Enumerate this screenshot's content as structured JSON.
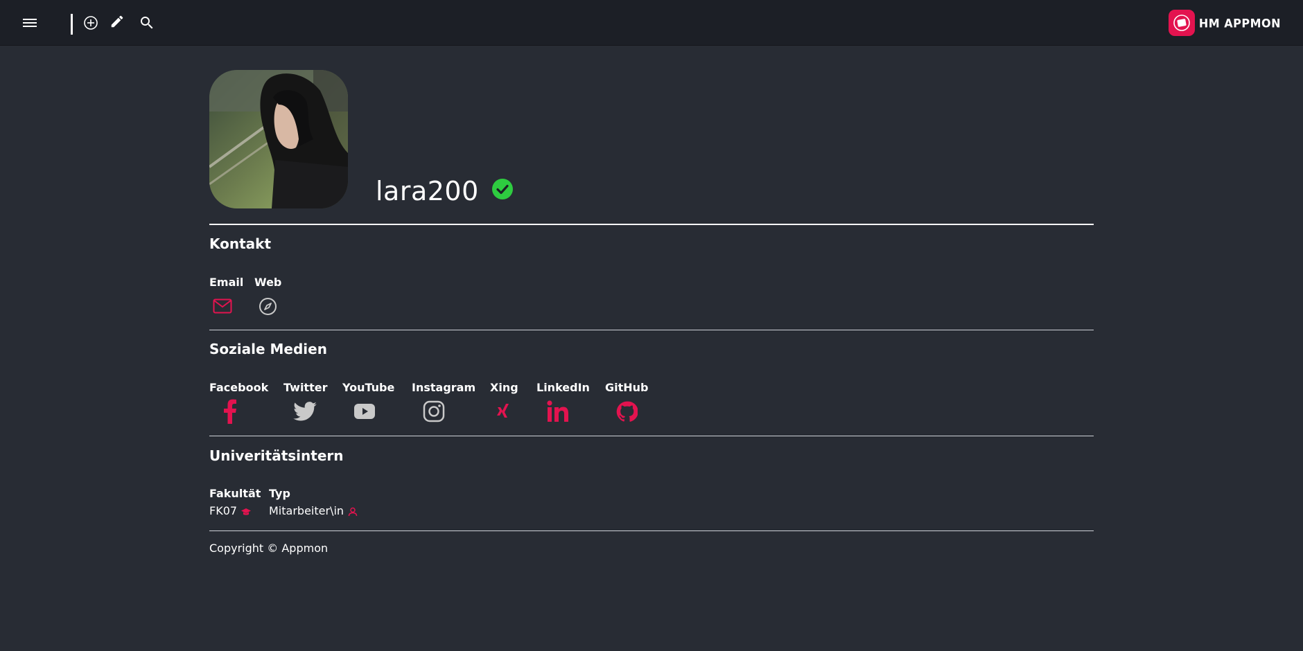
{
  "header": {
    "icons": [
      "menu-icon",
      "add-circle-icon",
      "pencil-icon",
      "search-icon"
    ],
    "brand_text": "HM APPMON",
    "brand_color": "#e3134f"
  },
  "profile": {
    "username": "lara200",
    "verified_color": "#2ecc40",
    "avatar": "profile-photo"
  },
  "sections": {
    "contact": {
      "title": "Kontakt",
      "email_label": "Email",
      "web_label": "Web"
    },
    "social": {
      "title": "Soziale Medien",
      "items": [
        "Facebook",
        "Twitter",
        "YouTube",
        "Instagram",
        "Xing",
        "LinkedIn",
        "GitHub"
      ]
    },
    "university": {
      "title": "Univeritätsintern",
      "faculty_label": "Fakultät",
      "faculty_value": "FK07",
      "type_label": "Typ",
      "type_value": "Mitarbeiter\\in"
    }
  },
  "footer": {
    "copyright": "Copyright © Appmon"
  },
  "colors": {
    "accent": "#e3134f",
    "gray_icon": "#c9c9c9",
    "background": "#282c34",
    "topbar": "#1c1f26"
  }
}
